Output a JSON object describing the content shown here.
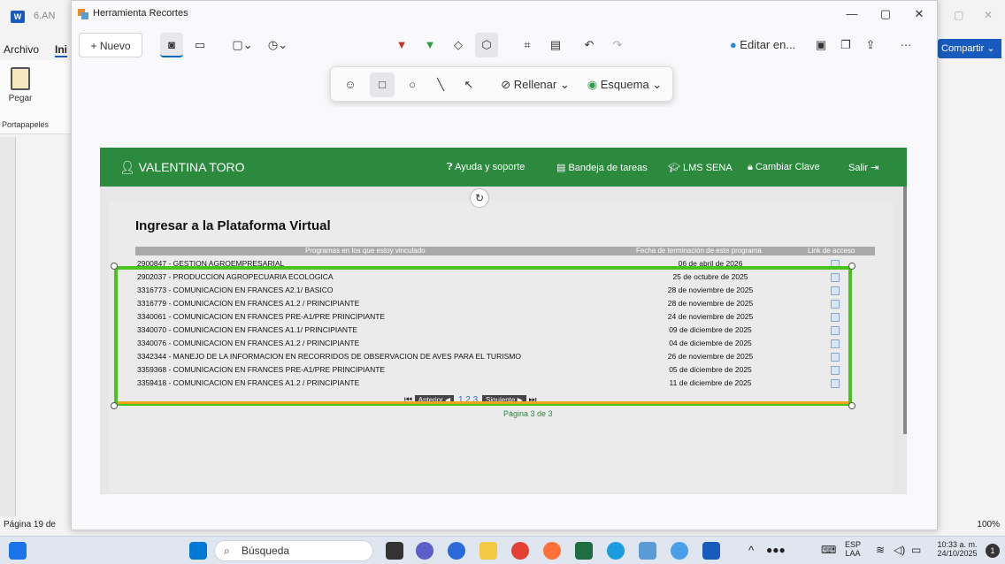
{
  "word": {
    "doc_name": "6.AN",
    "menu": [
      "Archivo",
      "Ini"
    ],
    "ribbon_paste": "Pegar",
    "ribbon_group": "Portapapeles",
    "share_label": "Compartir",
    "status_page": "Página 19 de",
    "zoom": "100%"
  },
  "snip": {
    "title": "Herramienta Recortes",
    "new_label": "Nuevo",
    "edit_in_label": "Editar en...",
    "fill_label": "Rellenar",
    "outline_label": "Esquema"
  },
  "site": {
    "user": "VALENTINA TORO",
    "nav": [
      "Ayuda y soporte",
      "Bandeja de tareas",
      "LMS SENA",
      "Cambiar Clave",
      "Salir"
    ],
    "panel_title": "Ingresar a la Plataforma Virtual",
    "columns": [
      "Programas en los que estoy vinculado",
      "Fecha de terminación de este programa",
      "Link de acceso"
    ],
    "rows": [
      {
        "program": "2900847 - GESTION AGROEMPRESARIAL",
        "date": "06 de abril de 2026"
      },
      {
        "program": "2902037 - PRODUCCION AGROPECUARIA ECOLOGICA",
        "date": "25 de octubre de 2025"
      },
      {
        "program": "3316773 - COMUNICACION EN FRANCES A2.1/ BASICO",
        "date": "28 de noviembre de 2025"
      },
      {
        "program": "3316779 - COMUNICACION EN FRANCES A1.2 / PRINCIPIANTE",
        "date": "28 de noviembre de 2025"
      },
      {
        "program": "3340061 - COMUNICACION EN FRANCES PRE-A1/PRE PRINCIPIANTE",
        "date": "24 de noviembre de 2025"
      },
      {
        "program": "3340070 - COMUNICACION EN FRANCES A1.1/ PRINCIPIANTE",
        "date": "09 de diciembre de 2025"
      },
      {
        "program": "3340076 - COMUNICACION EN FRANCES A1.2 / PRINCIPIANTE",
        "date": "04 de diciembre de 2025"
      },
      {
        "program": "3342344 - MANEJO DE LA INFORMACION EN RECORRIDOS DE OBSERVACION DE AVES PARA EL TURISMO",
        "date": "26 de noviembre de 2025"
      },
      {
        "program": "3359368 - COMUNICACION EN FRANCES PRE-A1/PRE PRINCIPIANTE",
        "date": "05 de diciembre de 2025"
      },
      {
        "program": "3359418 - COMUNICACION EN FRANCES A1.2 / PRINCIPIANTE",
        "date": "11 de diciembre de 2025"
      }
    ],
    "pager": {
      "prev": "Anterior",
      "next": "Siguiente",
      "pages": "1 2 3",
      "status": "Página 3 de 3"
    }
  },
  "taskbar": {
    "search_placeholder": "Búsqueda",
    "lang": "ESP",
    "layout": "LAA",
    "time": "10:33 a. m.",
    "date": "24/10/2025"
  },
  "colors": {
    "site_green": "#2b8a3e",
    "selection_green": "#4ac31f",
    "accent": "#185abd"
  }
}
